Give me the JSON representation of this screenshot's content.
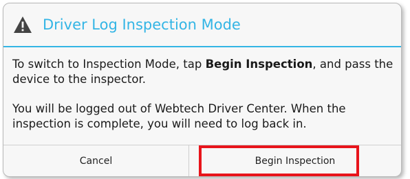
{
  "dialog": {
    "title": "Driver Log Inspection Mode",
    "icon": "warning-triangle-icon",
    "accent_color": "#33b5e5",
    "message1_prefix": "To switch to Inspection Mode, tap ",
    "message1_bold": "Begin Inspection",
    "message1_suffix": ", and pass the device to the inspector.",
    "message2": "You will be logged out of Webtech Driver Center. When the inspection is complete, you will need to log back in.",
    "cancel_label": "Cancel",
    "begin_label": "Begin Inspection"
  },
  "annotation": {
    "highlight_color": "#e8141b"
  }
}
